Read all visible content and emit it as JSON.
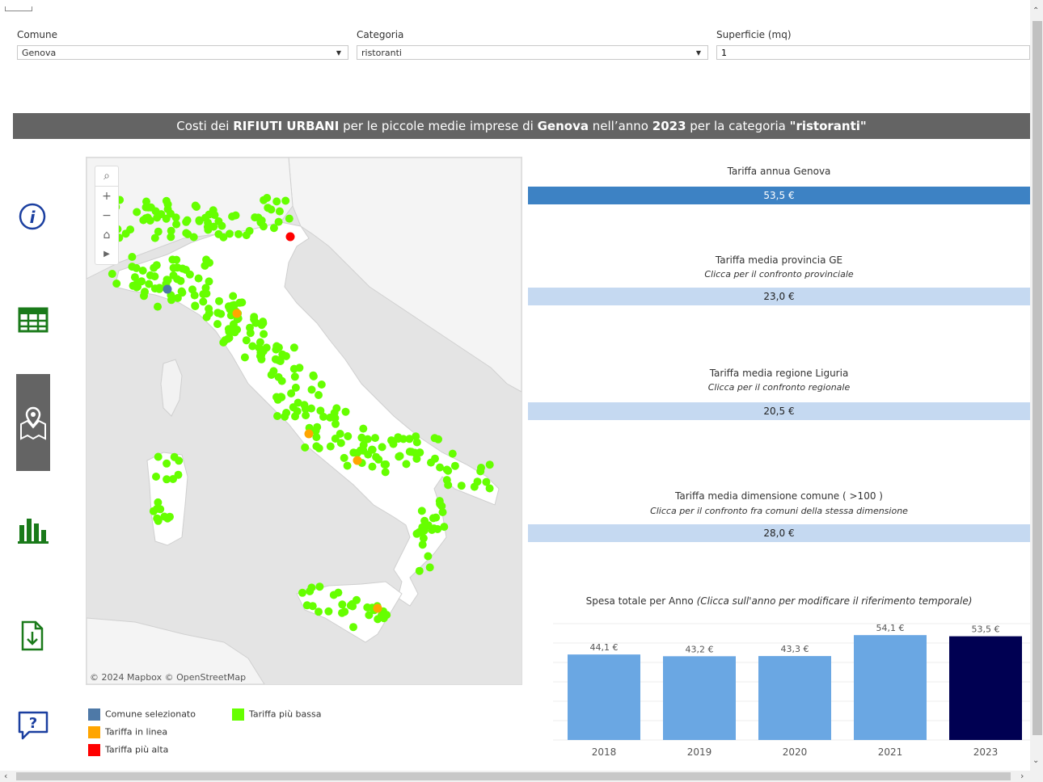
{
  "filters": {
    "comune": {
      "label": "Comune",
      "value": "Genova"
    },
    "categoria": {
      "label": "Categoria",
      "value": "ristoranti"
    },
    "superficie": {
      "label": "Superficie (mq)",
      "value": "1"
    }
  },
  "title": {
    "p1": "Costi dei ",
    "b1": "RIFIUTI URBANI",
    "p2": " per le piccole medie imprese di ",
    "b2": "Genova",
    "p3": " nell’anno ",
    "b3": "2023",
    "p4": " per la categoria ",
    "b4": "\"ristoranti\""
  },
  "sidebar": {
    "icons": [
      "info-icon",
      "table-icon",
      "map-icon",
      "bar-chart-icon",
      "download-icon",
      "help-icon"
    ]
  },
  "map": {
    "attribution": "© 2024 Mapbox  © OpenStreetMap"
  },
  "legend": {
    "selected": "Comune selezionato",
    "inline": "Tariffa in linea",
    "high": "Tariffa più alta",
    "low": "Tariffa più bassa"
  },
  "colors": {
    "selected": "#4e79a7",
    "inline": "#ffa500",
    "high": "#ff0000",
    "low": "#66ff00",
    "kpi_main": "#3d82c4",
    "kpi_light": "#c5d9f1",
    "bar": "#6aa7e3",
    "bar_selected": "#000052"
  },
  "kpis": {
    "annual": {
      "title": "Tariffa annua  Genova",
      "value": "53,5 €"
    },
    "province": {
      "title": "Tariffa media provincia GE",
      "subtitle": "Clicca per il confronto provinciale",
      "value": "23,0 €"
    },
    "region": {
      "title": "Tariffa media regione Liguria",
      "subtitle": "Clicca per il confronto regionale",
      "value": "20,5 €"
    },
    "size": {
      "title": "Tariffa media dimensione comune ( >100 )",
      "subtitle": "Clicca per il confronto fra comuni della stessa dimensione",
      "value": "28,0 €"
    }
  },
  "chart_title": {
    "main": "Spesa totale per Anno ",
    "italic": "(Clicca sull'anno per modificare il riferimento temporale)"
  },
  "chart_data": {
    "type": "bar",
    "categories": [
      "2018",
      "2019",
      "2020",
      "2021",
      "2023"
    ],
    "values": [
      44.1,
      43.2,
      43.3,
      54.1,
      53.5
    ],
    "labels": [
      "44,1 €",
      "43,2 €",
      "43,3 €",
      "54,1 €",
      "53,5 €"
    ],
    "selected": "2023",
    "ylim": [
      0,
      60
    ]
  }
}
